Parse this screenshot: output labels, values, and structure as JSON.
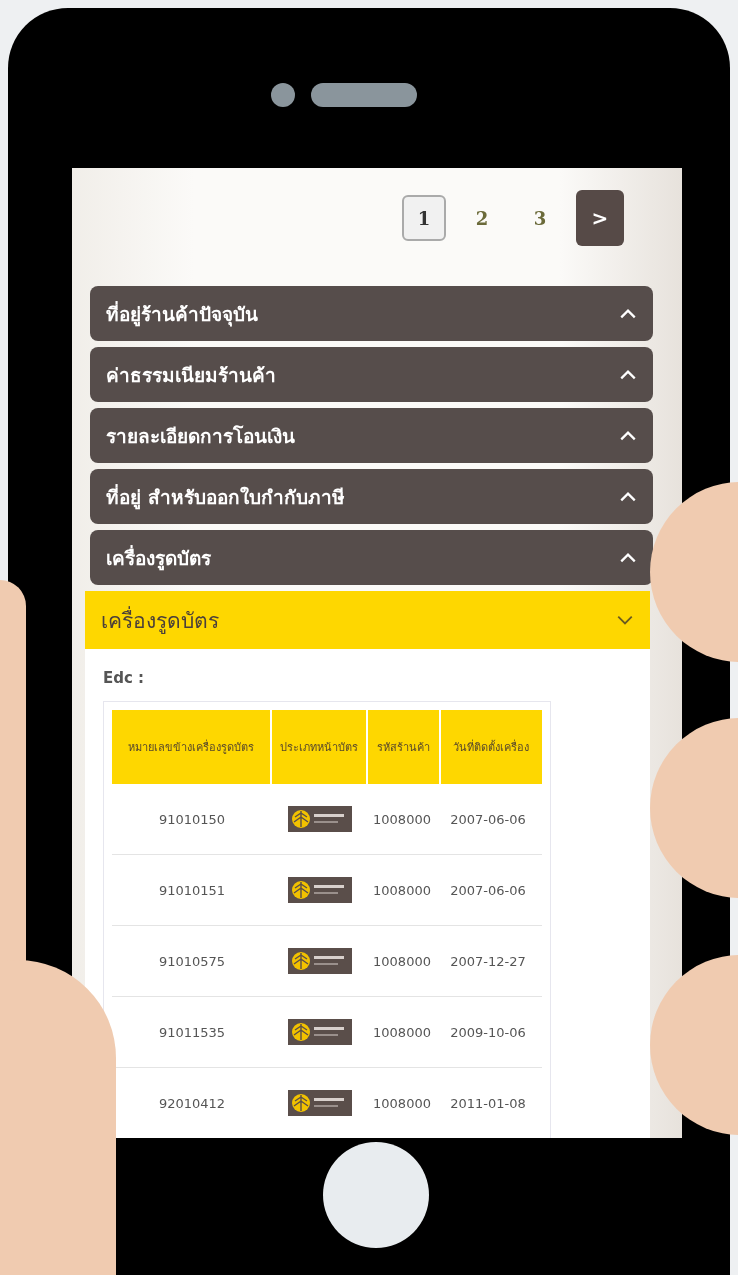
{
  "pagination": {
    "pages": [
      {
        "label": "1",
        "selected": true
      },
      {
        "label": "2",
        "selected": false
      },
      {
        "label": "3",
        "selected": false
      }
    ],
    "next": ">"
  },
  "accordion": [
    {
      "title": "ที่อยู่ร้านค้าปัจจุบัน",
      "expanded": false
    },
    {
      "title": "ค่าธรรมเนียมร้านค้า",
      "expanded": false
    },
    {
      "title": "รายละเอียดการโอนเงิน",
      "expanded": false
    },
    {
      "title": "ที่อยู่ สำหรับออกใบกำกับภาษี",
      "expanded": false
    },
    {
      "title": "เครื่องรูดบัตร",
      "expanded": false
    },
    {
      "title": "เครื่องรูดบัตร",
      "expanded": true
    }
  ],
  "edc_panel": {
    "label": "Edc :",
    "table": {
      "columns": [
        "หมายเลขข้างเครื่องรูดบัตร",
        "ประเภทหน้าบัตร",
        "รหัสร้านค้า",
        "วันที่ติดตั้งเครื่อง"
      ],
      "rows": [
        {
          "machine_no": "91010150",
          "store_code": "1008000",
          "install_date": "2007-06-06"
        },
        {
          "machine_no": "91010151",
          "store_code": "1008000",
          "install_date": "2007-06-06"
        },
        {
          "machine_no": "91010575",
          "store_code": "1008000",
          "install_date": "2007-12-27"
        },
        {
          "machine_no": "91011535",
          "store_code": "1008000",
          "install_date": "2009-10-06"
        },
        {
          "machine_no": "92010412",
          "store_code": "1008000",
          "install_date": "2011-01-08"
        }
      ]
    }
  }
}
